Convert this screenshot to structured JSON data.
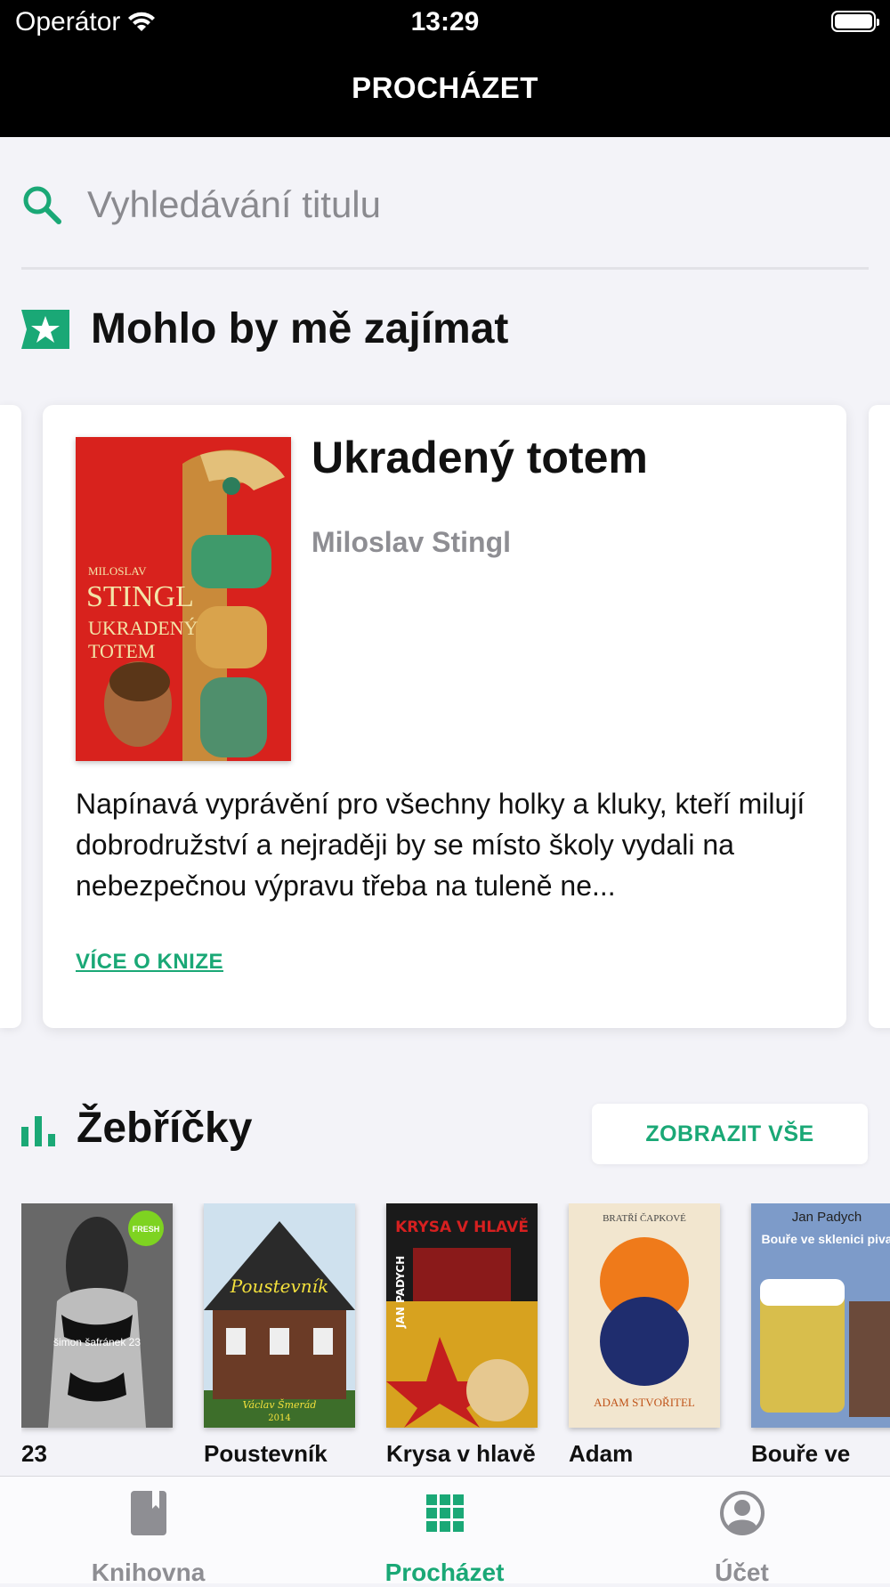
{
  "status_bar": {
    "carrier": "Operátor",
    "time": "13:29"
  },
  "nav": {
    "title": "PROCHÁZET"
  },
  "search": {
    "placeholder": "Vyhledávání titulu"
  },
  "recommend_section": {
    "title": "Mohlo by mě zajímat",
    "icon": "star-badge-icon"
  },
  "featured_book": {
    "title": "Ukradený totem",
    "author": "Miloslav Stingl",
    "description": "Napínavá vyprávění pro všechny holky a kluky, kteří milují dobrodružství a nejraději by se místo školy vydali na nebezpečnou výpravu třeba na tuleně ne...",
    "more_link": "VÍCE O KNIZE",
    "cover": {
      "line1": "MILOSLAV",
      "line2": "STINGL",
      "line3": "UKRADENÝ",
      "line4": "TOTEM"
    }
  },
  "charts_section": {
    "title": "Žebříčky",
    "show_all": "ZOBRAZIT VŠE",
    "icon": "bar-chart-icon"
  },
  "chart_books": [
    {
      "label": "23",
      "cover_text": "šimon šafránek 23",
      "badge": "FRESH"
    },
    {
      "label": "Poustevník",
      "cover_text": "Poustevník",
      "cover_sub": "Václav Šmerád",
      "cover_year": "2014"
    },
    {
      "label": "Krysa v hlavě",
      "cover_text": "KRYSA V HLAVĚ",
      "cover_side": "JAN PADYCH"
    },
    {
      "label": "Adam",
      "cover_top": "BRATŘÍ ČAPKOVÉ",
      "cover_text": "ADAM STVOŘITEL"
    },
    {
      "label": "Bouře ve",
      "cover_top": "Jan Padych",
      "cover_text": "Bouře ve sklenici piva"
    }
  ],
  "tabs": [
    {
      "label": "Knihovna",
      "icon": "book-icon",
      "active": false
    },
    {
      "label": "Procházet",
      "icon": "grid-icon",
      "active": true
    },
    {
      "label": "Účet",
      "icon": "account-icon",
      "active": false
    }
  ],
  "colors": {
    "accent": "#1aa876",
    "nav_bg": "#000000",
    "page_bg": "#f3f3f8",
    "muted": "#8e8e93"
  }
}
